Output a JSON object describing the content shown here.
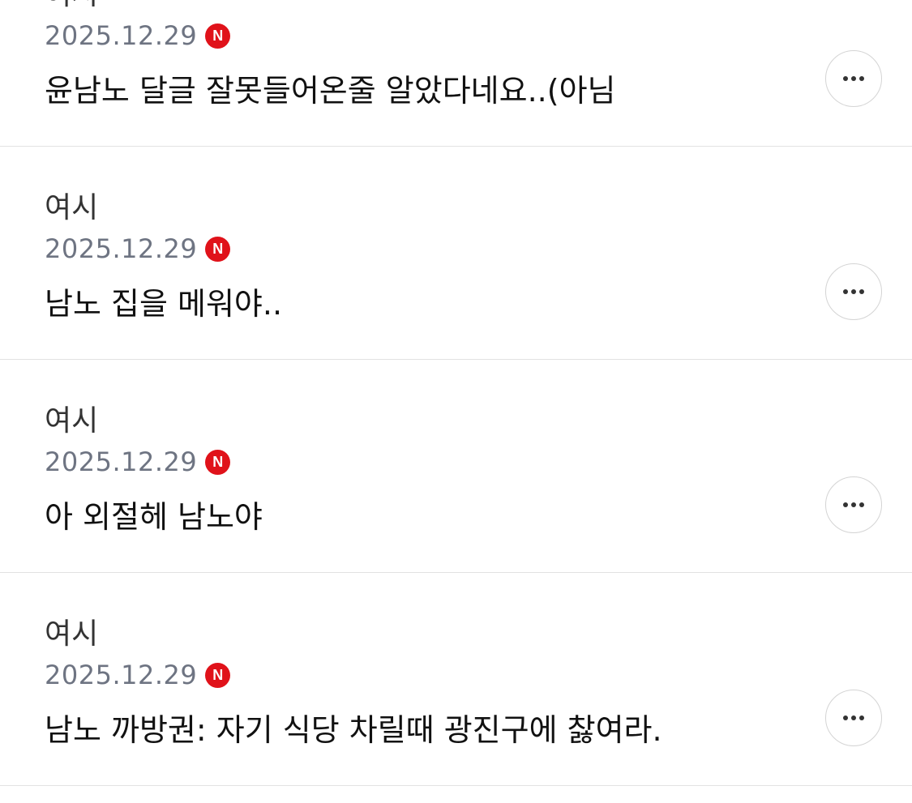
{
  "comments": [
    {
      "author": "여시",
      "date": "2025.12.29",
      "badge": "N",
      "text": "윤남노 달글 잘못들어온줄 알았다네요..(아님"
    },
    {
      "author": "여시",
      "date": "2025.12.29",
      "badge": "N",
      "text": "남노 집을 메워야.."
    },
    {
      "author": "여시",
      "date": "2025.12.29",
      "badge": "N",
      "text": "아 외절헤 남노야"
    },
    {
      "author": "여시",
      "date": "2025.12.29",
      "badge": "N",
      "text": "남노 까방권: 자기 식당 차릴때 광진구에 찷여라."
    }
  ],
  "icons": {
    "more": "more-horizontal-icon",
    "new_badge": "new-badge-icon"
  },
  "colors": {
    "badge": "#e0121a",
    "date": "#6e7482",
    "divider": "#e2e2e2"
  }
}
